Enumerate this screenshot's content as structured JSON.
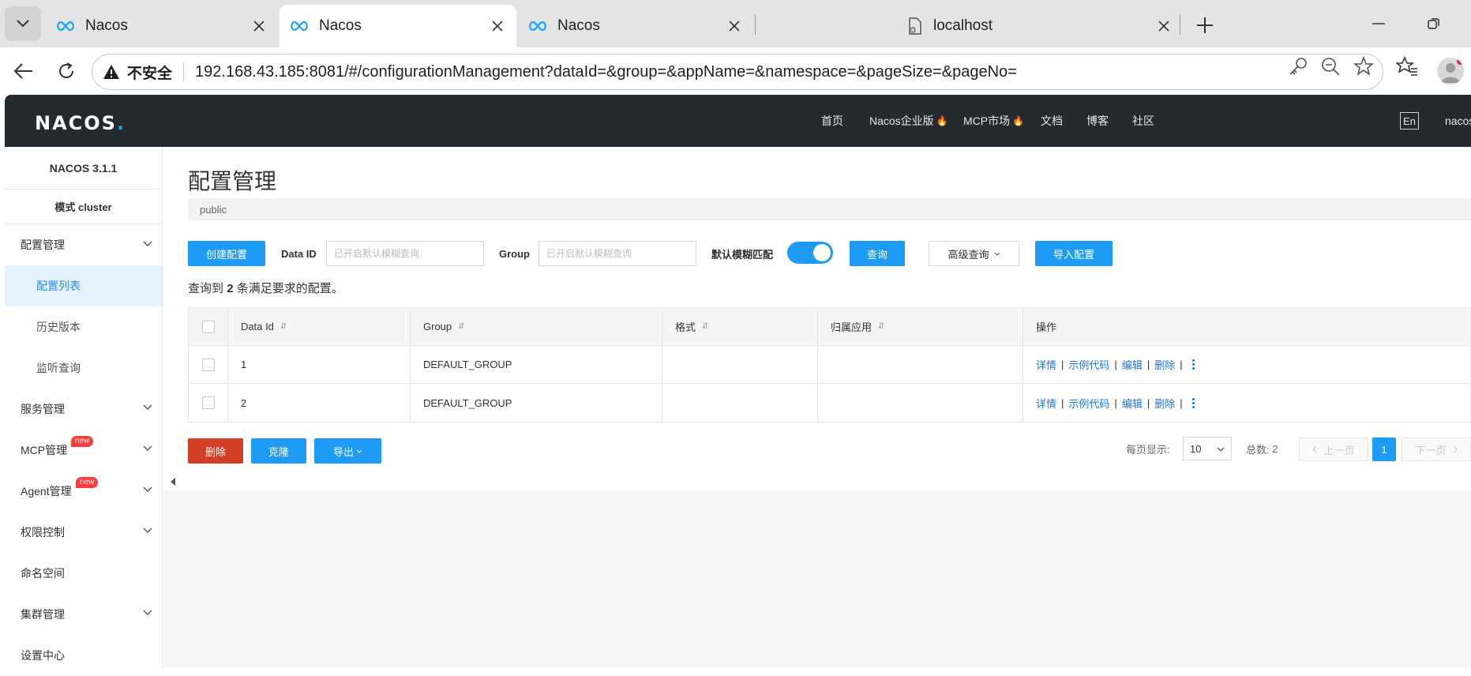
{
  "browser": {
    "tabs": [
      {
        "title": "Nacos",
        "favicon": "nacos-infinity-icon",
        "active": false
      },
      {
        "title": "Nacos",
        "favicon": "nacos-infinity-icon",
        "active": true
      },
      {
        "title": "Nacos",
        "favicon": "nacos-infinity-icon",
        "active": false
      },
      {
        "title": "localhost",
        "favicon": "broken-page-icon",
        "active": false
      }
    ],
    "security_label": "不安全",
    "url": "192.168.43.185:8081/#/configurationManagement?dataId=&group=&appName=&namespace=&pageSize=&pageNo="
  },
  "header": {
    "logo_text": "NACOS",
    "logo_dot": ".",
    "nav": [
      {
        "label": "首页",
        "hot": false
      },
      {
        "label": "Nacos企业版",
        "hot": true
      },
      {
        "label": "MCP市场",
        "hot": true
      },
      {
        "label": "文档",
        "hot": false
      },
      {
        "label": "博客",
        "hot": false
      },
      {
        "label": "社区",
        "hot": false
      }
    ],
    "lang": "En",
    "user": "nacos"
  },
  "sidebar": {
    "version": "NACOS 3.1.1",
    "mode": "模式 cluster",
    "config_menu": "配置管理",
    "config_sub": [
      "配置列表",
      "历史版本",
      "监听查询"
    ],
    "menus": [
      {
        "label": "服务管理",
        "chevron": true,
        "badge": ""
      },
      {
        "label": "MCP管理",
        "chevron": true,
        "badge": "new"
      },
      {
        "label": "Agent管理",
        "chevron": true,
        "badge": "new"
      },
      {
        "label": "权限控制",
        "chevron": true,
        "badge": ""
      },
      {
        "label": "命名空间",
        "chevron": false,
        "badge": ""
      },
      {
        "label": "集群管理",
        "chevron": true,
        "badge": ""
      },
      {
        "label": "设置中心",
        "chevron": false,
        "badge": ""
      }
    ]
  },
  "main": {
    "title": "配置管理",
    "namespace": "public",
    "create_btn": "创建配置",
    "dataid_label": "Data ID",
    "dataid_placeholder": "已开启默认模糊查询",
    "group_label": "Group",
    "group_placeholder": "已开启默认模糊查询",
    "fuzzy_label": "默认模糊匹配",
    "fuzzy_on": true,
    "query_btn": "查询",
    "advanced_btn": "高级查询",
    "import_btn": "导入配置",
    "result_prefix": "查询到",
    "result_count": "2",
    "result_suffix": "条满足要求的配置。",
    "columns": [
      "Data Id",
      "Group",
      "格式",
      "归属应用",
      "操作"
    ],
    "rows": [
      {
        "data_id": "1",
        "group": "DEFAULT_GROUP",
        "format": "",
        "app": ""
      },
      {
        "data_id": "2",
        "group": "DEFAULT_GROUP",
        "format": "",
        "app": ""
      }
    ],
    "ops": [
      "详情",
      "示例代码",
      "编辑",
      "删除"
    ],
    "delete_btn": "删除",
    "clone_btn": "克隆",
    "export_btn": "导出",
    "page_size_label": "每页显示:",
    "page_size": "10",
    "total_label": "总数:",
    "total": "2",
    "prev": "上一页",
    "current_page": "1",
    "next": "下一页"
  },
  "colors": {
    "primary": "#1d9bf5",
    "danger": "#d23f27",
    "header_bg": "#252a2f",
    "link": "#1d74d6"
  }
}
